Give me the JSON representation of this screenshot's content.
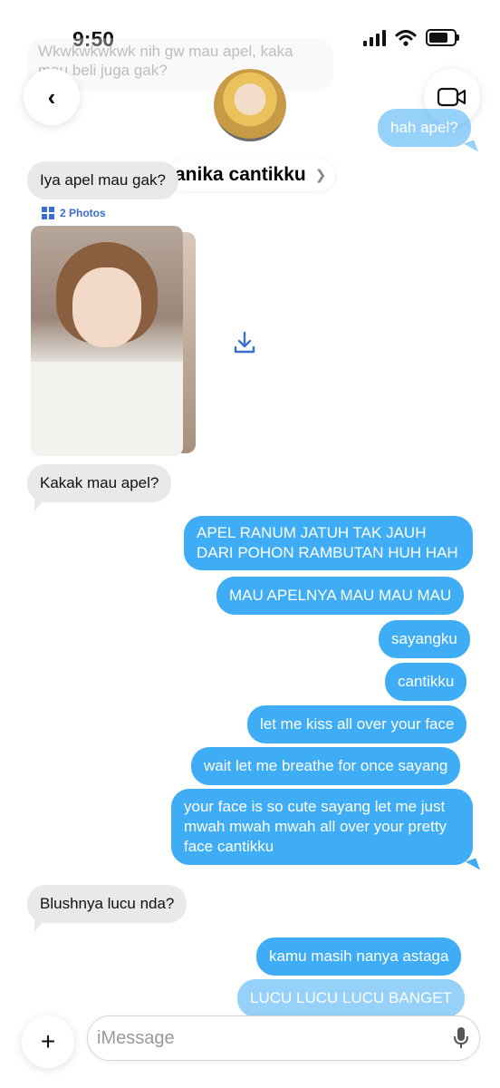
{
  "status_bar": {
    "time": "9:50"
  },
  "faded_message": {
    "text": "Wkwkwkwkwk nih gw mau apel, kaka mau beli juga gak?"
  },
  "header": {
    "back_label": "‹",
    "contact_name": "anika cantikku",
    "chevron": "❯",
    "video_icon": "video-camera-icon"
  },
  "photos": {
    "label": "2 Photos",
    "count": 2
  },
  "messages": {
    "m1": "hah apel?",
    "m2": "Iya apel mau gak?",
    "m3": "Kakak mau apel?",
    "m4_line1": "APEL RANUM JATUH TAK JAUH",
    "m4_line2": "DARI POHON RAMBUTAN HUH HAH",
    "m5": "MAU APELNYA MAU MAU MAU",
    "m6": "sayangku",
    "m7": "cantikku",
    "m8": "let me kiss all over your face",
    "m9": "wait let me breathe for once sayang",
    "m10_line1": "your face is so cute sayang let me just",
    "m10_line2": "mwah mwah mwah all over your pretty",
    "m10_line3": "face cantikku",
    "m11": "Blushnya lucu nda?",
    "m12": "kamu masih nanya astaga",
    "m13": "LUCU LUCU LUCU BANGET"
  },
  "input": {
    "plus_label": "+",
    "placeholder": "iMessage"
  },
  "colors": {
    "outgoing": "#3fadf5",
    "incoming": "#e9e9eb",
    "link": "#3a6fd1"
  }
}
